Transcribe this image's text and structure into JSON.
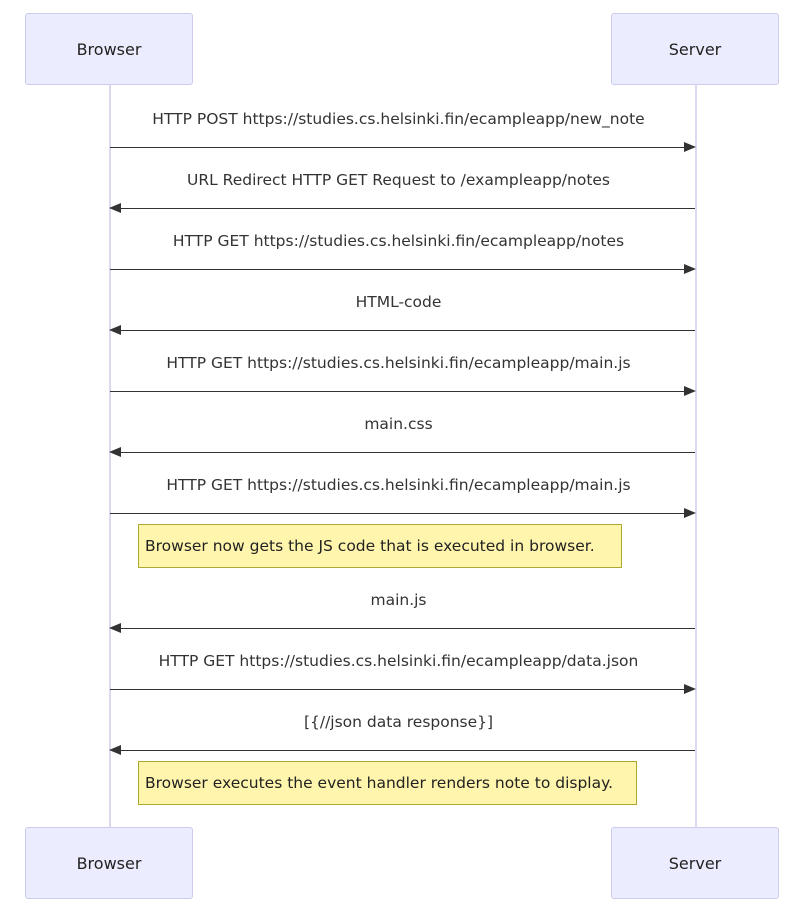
{
  "actors": {
    "browser": "Browser",
    "server": "Server"
  },
  "messages": [
    {
      "text": "HTTP POST https://studies.cs.helsinki.fin/ecampleapp/new_note",
      "direction": "right"
    },
    {
      "text": "URL Redirect HTTP GET Request to /exampleapp/notes",
      "direction": "left"
    },
    {
      "text": "HTTP GET https://studies.cs.helsinki.fin/ecampleapp/notes",
      "direction": "right"
    },
    {
      "text": "HTML-code",
      "direction": "left"
    },
    {
      "text": "HTTP GET https://studies.cs.helsinki.fin/ecampleapp/main.js",
      "direction": "right"
    },
    {
      "text": "main.css",
      "direction": "left"
    },
    {
      "text": "HTTP GET https://studies.cs.helsinki.fin/ecampleapp/main.js",
      "direction": "right"
    },
    {
      "text": "main.js",
      "direction": "left"
    },
    {
      "text": "HTTP GET https://studies.cs.helsinki.fin/ecampleapp/data.json",
      "direction": "right"
    },
    {
      "text": "[{//json data response}]",
      "direction": "left"
    }
  ],
  "notes": [
    {
      "text": "Browser now gets the JS code that is executed in browser."
    },
    {
      "text": "Browser executes the event handler renders note to display."
    }
  ],
  "colors": {
    "actor_fill": "#ececff",
    "actor_border": "#ccccee",
    "lifeline": "#d9d9f0",
    "arrow": "#333333",
    "note_fill": "#fff5ad",
    "note_border": "#aaaa33"
  }
}
